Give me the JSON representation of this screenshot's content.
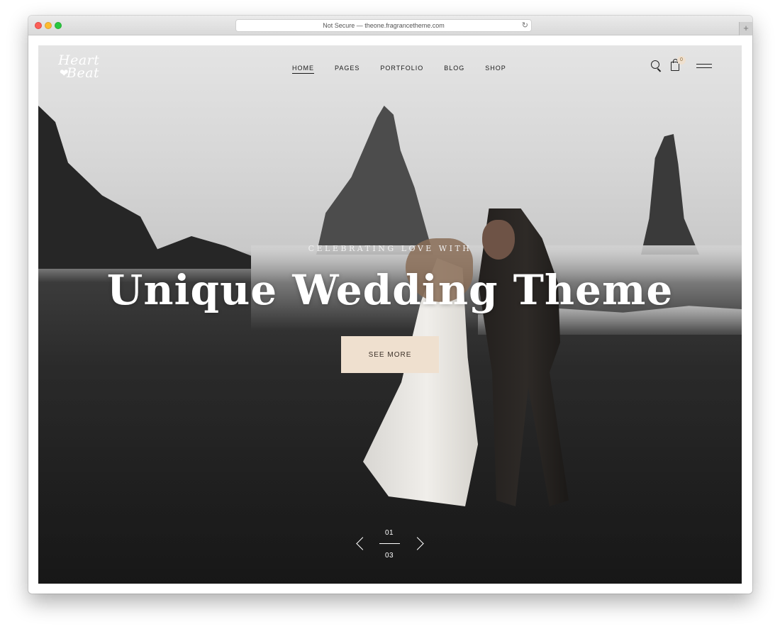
{
  "browser": {
    "address": "Not Secure — theone.fragrancetheme.com",
    "new_tab_symbol": "+",
    "reload_icon": "reload-icon"
  },
  "site": {
    "logo": {
      "line1": "Heart",
      "line2": "Beat",
      "heart_symbol": "❤"
    },
    "nav": [
      {
        "label": "HOME",
        "active": true
      },
      {
        "label": "PAGES"
      },
      {
        "label": "PORTFOLIO"
      },
      {
        "label": "BLOG"
      },
      {
        "label": "SHOP"
      }
    ],
    "icons": [
      "search-icon",
      "bag-icon",
      "menu-icon"
    ],
    "cart_count": "0"
  },
  "hero": {
    "eyebrow": "CELEBRATING LOVE WITH",
    "headline": "Unique Wedding Theme",
    "cta_label": "SEE MORE",
    "accent_color": "#efe0cf"
  },
  "slider": {
    "current": "01",
    "total": "03"
  }
}
